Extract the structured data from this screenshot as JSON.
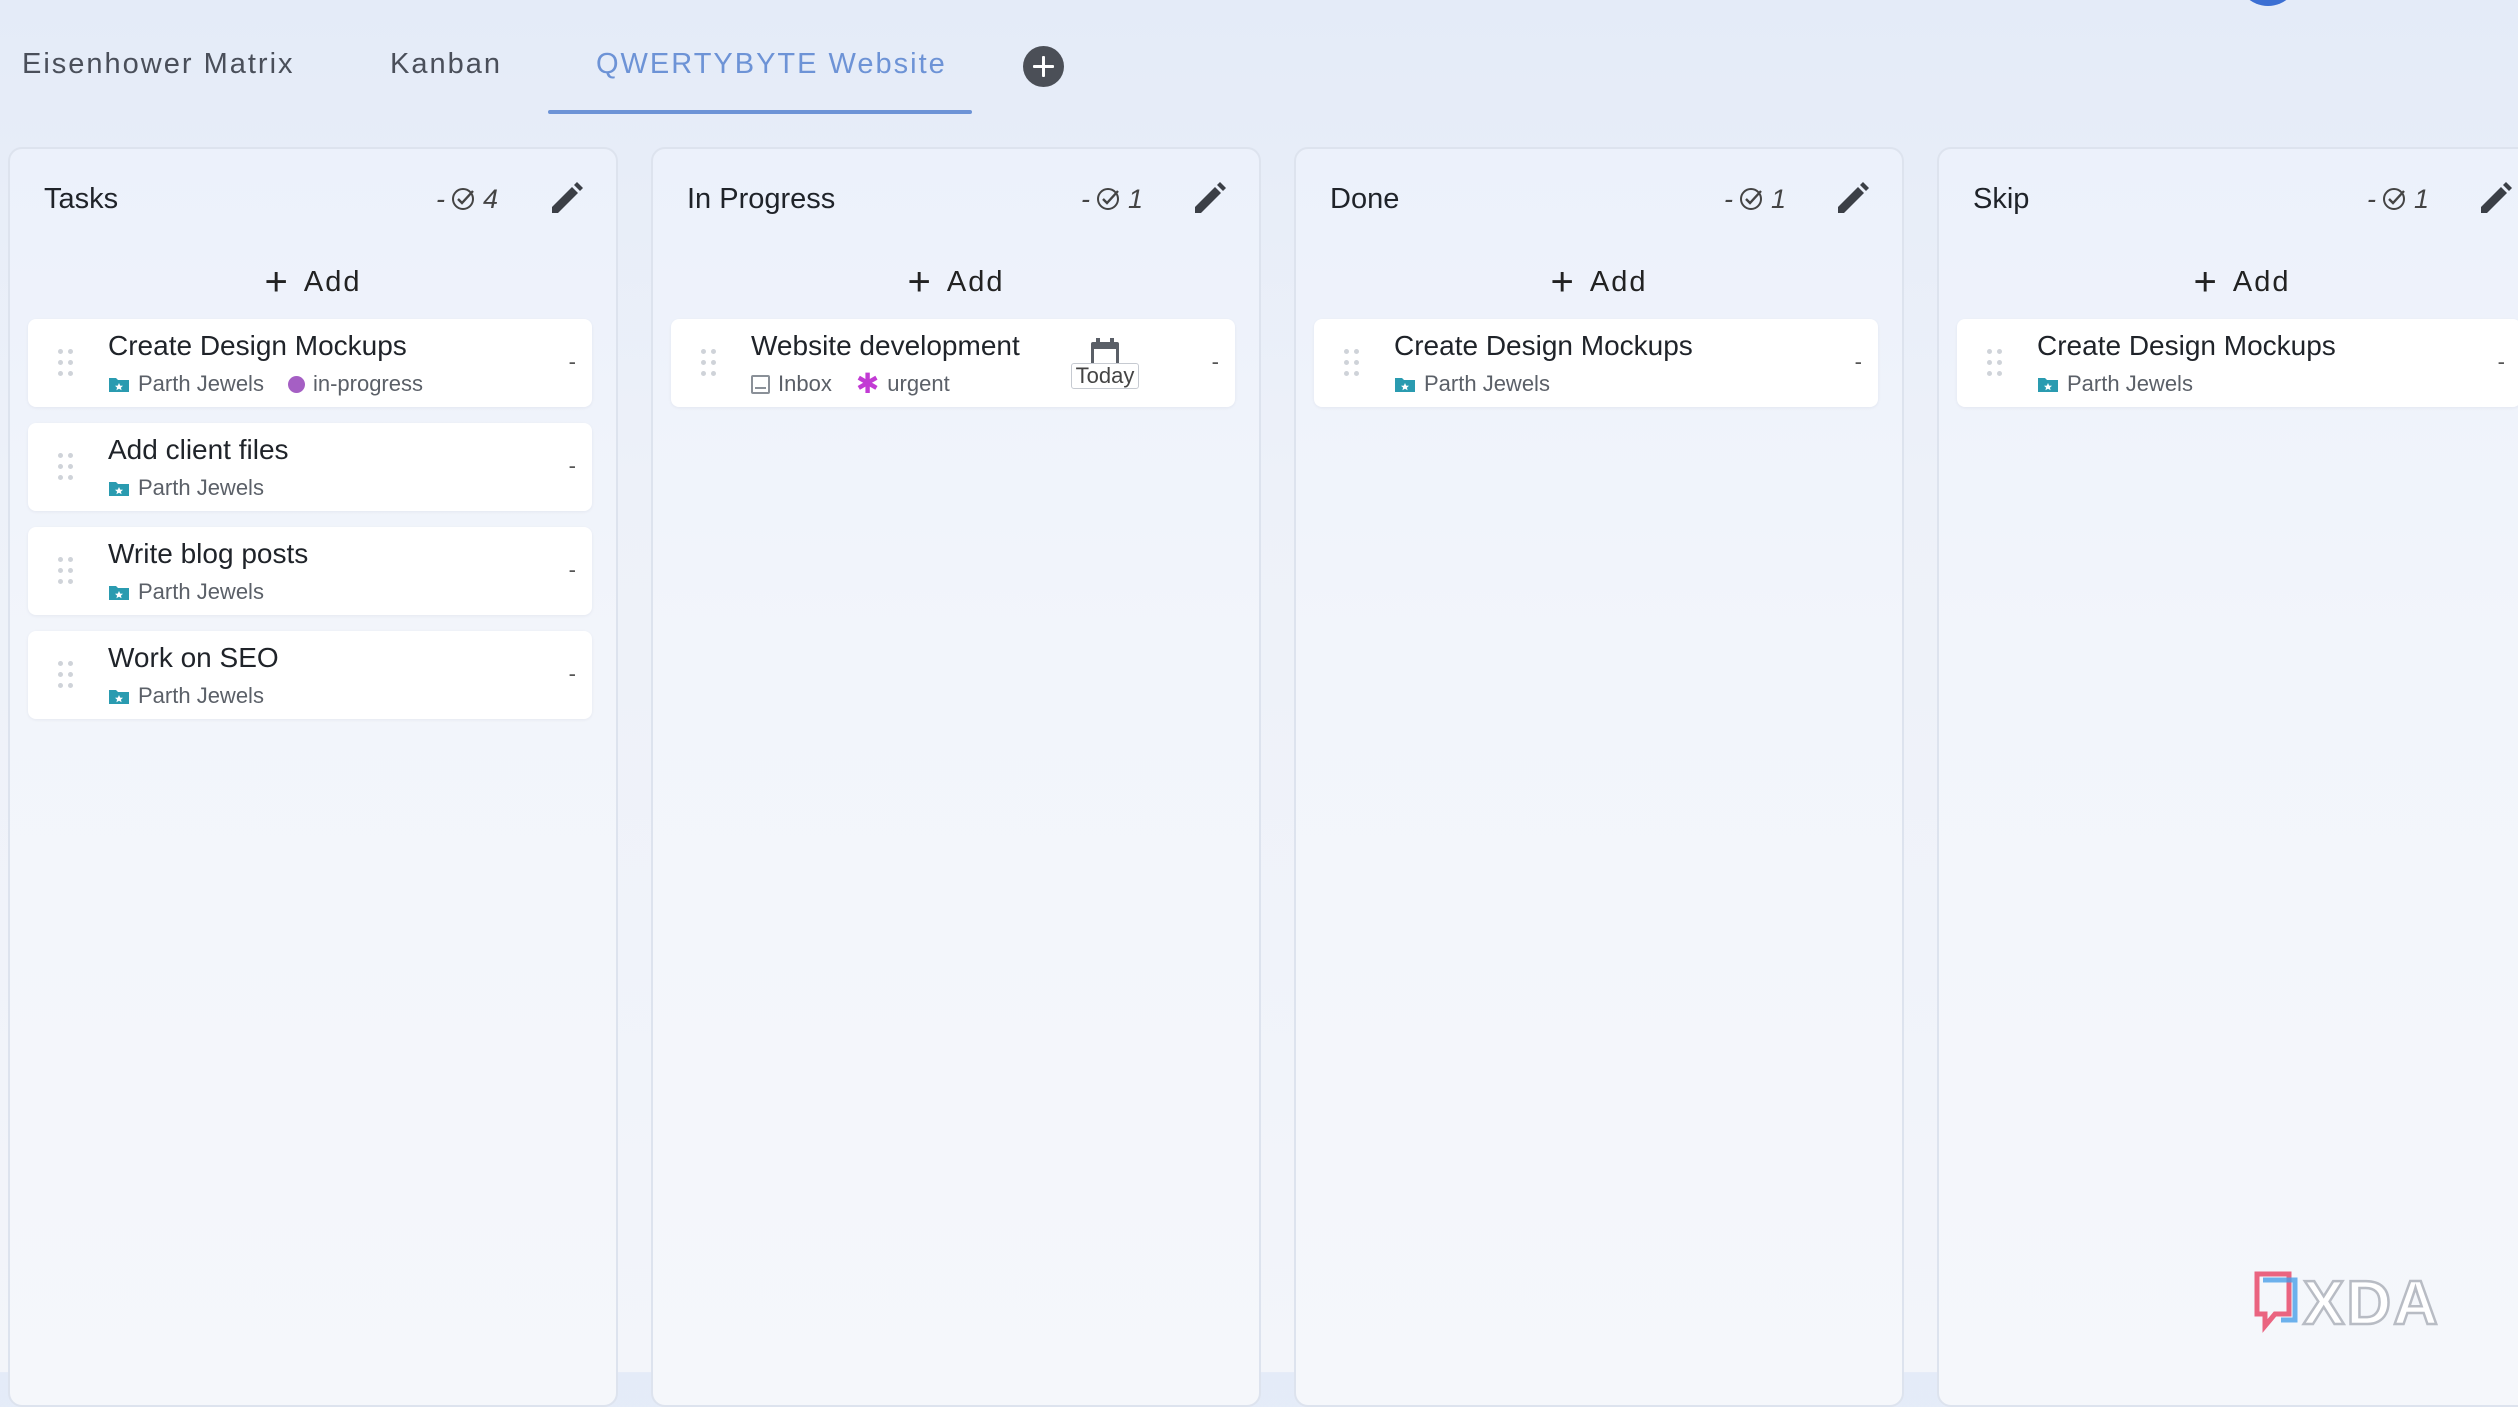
{
  "tabs": [
    {
      "label": "Eisenhower Matrix",
      "active": false
    },
    {
      "label": "Kanban",
      "active": false
    },
    {
      "label": "QWERTYBYTE Website",
      "active": true
    }
  ],
  "add_tab_icon": "plus-circle-icon",
  "columns": [
    {
      "title": "Tasks",
      "count_prefix": "-",
      "count": "4",
      "add_label": "Add",
      "cards": [
        {
          "title": "Create Design Mockups",
          "project": "Parth Jewels",
          "tag": "in-progress",
          "dash": "-"
        },
        {
          "title": "Add client files",
          "project": "Parth Jewels",
          "dash": "-"
        },
        {
          "title": "Write blog posts",
          "project": "Parth Jewels",
          "dash": "-"
        },
        {
          "title": "Work on SEO",
          "project": "Parth Jewels",
          "dash": "-"
        }
      ]
    },
    {
      "title": "In Progress",
      "count_prefix": "-",
      "count": "1",
      "add_label": "Add",
      "cards": [
        {
          "title": "Website development",
          "project": "Inbox",
          "tag": "urgent",
          "due": "Today",
          "dash": "-"
        }
      ]
    },
    {
      "title": "Done",
      "count_prefix": "-",
      "count": "1",
      "add_label": "Add",
      "cards": [
        {
          "title": "Create Design Mockups",
          "project": "Parth Jewels",
          "dash": "-"
        }
      ]
    },
    {
      "title": "Skip",
      "count_prefix": "-",
      "count": "1",
      "add_label": "Add",
      "cards": [
        {
          "title": "Create Design Mockups",
          "project": "Parth Jewels",
          "dash": "-"
        }
      ]
    }
  ],
  "colors": {
    "accent": "#6d93d6",
    "project_folder": "#2a9bb0",
    "tag_in_progress": "#a55fc4",
    "tag_urgent": "#c23bd4"
  },
  "watermark": "XDA"
}
